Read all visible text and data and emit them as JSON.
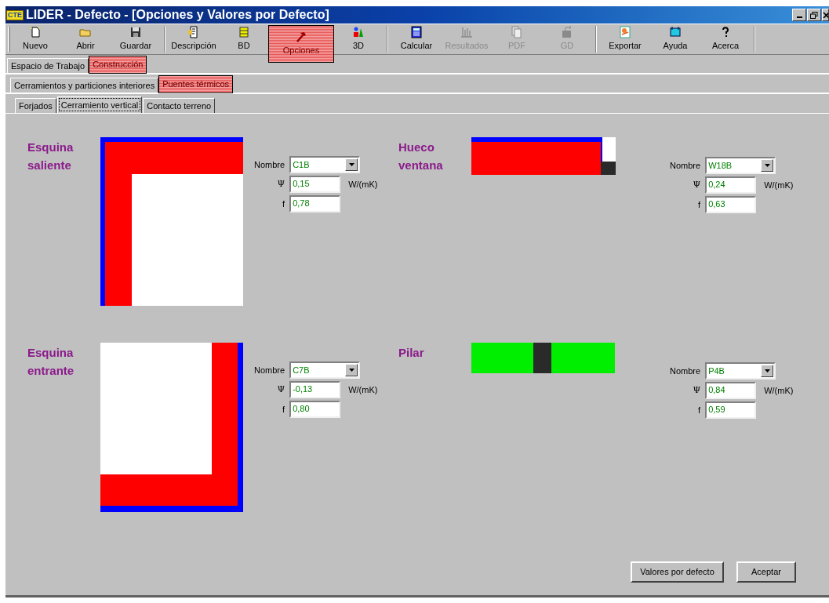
{
  "window": {
    "title": "LIDER - Defecto - [Opciones y Valores por Defecto]",
    "logo": "CTE"
  },
  "toolbar_groups": [
    [
      {
        "label": "Nuevo",
        "kind": "page",
        "disabled": false,
        "highlighted": false
      },
      {
        "label": "Abrir",
        "kind": "folder",
        "disabled": false,
        "highlighted": false
      },
      {
        "label": "Guardar",
        "kind": "disk",
        "disabled": false,
        "highlighted": false
      }
    ],
    [
      {
        "label": "Descripción",
        "kind": "doc",
        "disabled": false,
        "highlighted": false
      },
      {
        "label": "BD",
        "kind": "db",
        "disabled": false,
        "highlighted": false
      },
      {
        "label": "Opciones",
        "kind": "hammer",
        "disabled": false,
        "highlighted": true
      },
      {
        "label": "3D",
        "kind": "shapes",
        "disabled": false,
        "highlighted": false
      }
    ],
    [
      {
        "label": "Calcular",
        "kind": "calc",
        "disabled": false,
        "highlighted": false
      },
      {
        "label": "Resultados",
        "kind": "bars",
        "disabled": true,
        "highlighted": false
      },
      {
        "label": "PDF",
        "kind": "pages",
        "disabled": true,
        "highlighted": false
      },
      {
        "label": "GD",
        "kind": "box",
        "disabled": true,
        "highlighted": false
      }
    ],
    [
      {
        "label": "Exportar",
        "kind": "export",
        "disabled": false,
        "highlighted": false
      },
      {
        "label": "Ayuda",
        "kind": "help",
        "disabled": false,
        "highlighted": false
      },
      {
        "label": "Acerca",
        "kind": "question",
        "disabled": false,
        "highlighted": false
      }
    ]
  ],
  "tab_rows": [
    [
      {
        "label": "Espacio de Trabajo",
        "selected": false,
        "highlighted": false
      },
      {
        "label": "Construcción",
        "selected": true,
        "highlighted": true
      }
    ],
    [
      {
        "label": "Cerramientos y particiones interiores",
        "selected": false,
        "highlighted": false
      },
      {
        "label": "Puentes térmicos",
        "selected": true,
        "highlighted": true
      }
    ],
    [
      {
        "label": "Forjados",
        "selected": false,
        "highlighted": false
      },
      {
        "label": "Cerramiento vertical",
        "selected": true,
        "highlighted": false
      },
      {
        "label": "Contacto terreno",
        "selected": false,
        "highlighted": false
      }
    ]
  ],
  "bridges": [
    {
      "kind": "esquina_saliente",
      "title": "Esquina saliente",
      "name_label": "Nombre",
      "name": "C1B",
      "psi_label": "Ψ",
      "psi": "0,15",
      "unit": "W/(mK)",
      "f_label": "f",
      "f": "0,78"
    },
    {
      "kind": "hueco_ventana",
      "title": "Hueco ventana",
      "name_label": "Nombre",
      "name": "W18B",
      "psi_label": "Ψ",
      "psi": "0,24",
      "unit": "W/(mK)",
      "f_label": "f",
      "f": "0,63"
    },
    {
      "kind": "esquina_entrante",
      "title": "Esquina entrante",
      "name_label": "Nombre",
      "name": "C7B",
      "psi_label": "Ψ",
      "psi": "-0,13",
      "unit": "W/(mK)",
      "f_label": "f",
      "f": "0,80"
    },
    {
      "kind": "pilar",
      "title": "Pilar",
      "name_label": "Nombre",
      "name": "P4B",
      "psi_label": "Ψ",
      "psi": "0,84",
      "unit": "W/(mK)",
      "f_label": "f",
      "f": "0,59"
    }
  ],
  "buttons": [
    "Valores por defecto",
    "Aceptar"
  ]
}
